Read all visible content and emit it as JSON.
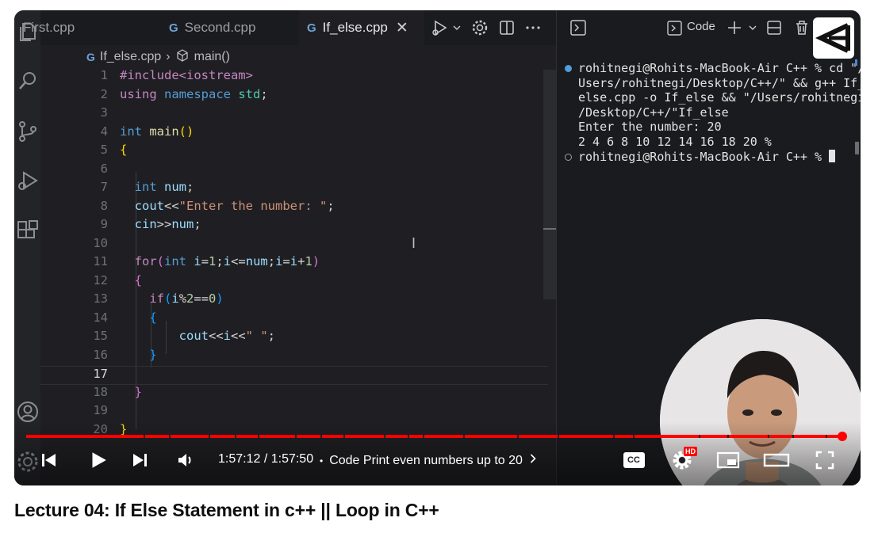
{
  "editor": {
    "tabs": [
      {
        "label": "First.cpp",
        "active": false
      },
      {
        "label": "Second.cpp",
        "active": false
      },
      {
        "label": "If_else.cpp",
        "active": true
      }
    ],
    "tab_file_glyph": "G",
    "tab_close_glyph": "✕",
    "breadcrumb": {
      "file": "If_else.cpp",
      "separator": "›",
      "symbol": "main()"
    },
    "current_line": 17,
    "lines": [
      {
        "n": "1",
        "tokens": [
          {
            "t": "#include<iostream>",
            "c": "pre"
          }
        ]
      },
      {
        "n": "2",
        "tokens": [
          {
            "t": "using ",
            "c": "pink"
          },
          {
            "t": "namespace ",
            "c": "blue"
          },
          {
            "t": "std",
            "c": "ns"
          },
          {
            "t": ";",
            "c": "op"
          }
        ]
      },
      {
        "n": "3",
        "tokens": []
      },
      {
        "n": "4",
        "tokens": [
          {
            "t": "int ",
            "c": "blue"
          },
          {
            "t": "main",
            "c": "fn"
          },
          {
            "t": "()",
            "c": "br1"
          }
        ]
      },
      {
        "n": "5",
        "tokens": [
          {
            "t": "{",
            "c": "br1"
          }
        ]
      },
      {
        "n": "6",
        "tokens": []
      },
      {
        "n": "7",
        "tokens": [
          {
            "t": "  int ",
            "c": "blue"
          },
          {
            "t": "num",
            "c": "ident"
          },
          {
            "t": ";",
            "c": "op"
          }
        ]
      },
      {
        "n": "8",
        "tokens": [
          {
            "t": "  cout",
            "c": "ident"
          },
          {
            "t": "<<",
            "c": "op"
          },
          {
            "t": "\"Enter the number: \"",
            "c": "str"
          },
          {
            "t": ";",
            "c": "op"
          }
        ]
      },
      {
        "n": "9",
        "tokens": [
          {
            "t": "  cin",
            "c": "ident"
          },
          {
            "t": ">>",
            "c": "op"
          },
          {
            "t": "num",
            "c": "ident"
          },
          {
            "t": ";",
            "c": "op"
          }
        ]
      },
      {
        "n": "10",
        "tokens": []
      },
      {
        "n": "11",
        "tokens": [
          {
            "t": "  for",
            "c": "pink"
          },
          {
            "t": "(",
            "c": "br2"
          },
          {
            "t": "int ",
            "c": "blue"
          },
          {
            "t": "i",
            "c": "ident"
          },
          {
            "t": "=",
            "c": "op"
          },
          {
            "t": "1",
            "c": "num"
          },
          {
            "t": ";",
            "c": "op"
          },
          {
            "t": "i",
            "c": "ident"
          },
          {
            "t": "<=",
            "c": "op"
          },
          {
            "t": "num",
            "c": "ident"
          },
          {
            "t": ";",
            "c": "op"
          },
          {
            "t": "i",
            "c": "ident"
          },
          {
            "t": "=",
            "c": "op"
          },
          {
            "t": "i",
            "c": "ident"
          },
          {
            "t": "+",
            "c": "op"
          },
          {
            "t": "1",
            "c": "num"
          },
          {
            "t": ")",
            "c": "br2"
          }
        ]
      },
      {
        "n": "12",
        "tokens": [
          {
            "t": "  {",
            "c": "br2"
          }
        ]
      },
      {
        "n": "13",
        "tokens": [
          {
            "t": "    if",
            "c": "pink"
          },
          {
            "t": "(",
            "c": "br3"
          },
          {
            "t": "i",
            "c": "ident"
          },
          {
            "t": "%",
            "c": "op"
          },
          {
            "t": "2",
            "c": "num"
          },
          {
            "t": "==",
            "c": "op"
          },
          {
            "t": "0",
            "c": "num"
          },
          {
            "t": ")",
            "c": "br3"
          }
        ]
      },
      {
        "n": "14",
        "tokens": [
          {
            "t": "    {",
            "c": "br3"
          }
        ]
      },
      {
        "n": "15",
        "tokens": [
          {
            "t": "        cout",
            "c": "ident"
          },
          {
            "t": "<<",
            "c": "op"
          },
          {
            "t": "i",
            "c": "ident"
          },
          {
            "t": "<<",
            "c": "op"
          },
          {
            "t": "\" \"",
            "c": "str"
          },
          {
            "t": ";",
            "c": "op"
          }
        ]
      },
      {
        "n": "16",
        "tokens": [
          {
            "t": "    }",
            "c": "br3"
          }
        ]
      },
      {
        "n": "17",
        "tokens": []
      },
      {
        "n": "18",
        "tokens": [
          {
            "t": "  }",
            "c": "br2"
          }
        ]
      },
      {
        "n": "19",
        "tokens": []
      },
      {
        "n": "20",
        "tokens": [
          {
            "t": "}",
            "c": "br1"
          }
        ]
      }
    ]
  },
  "terminal": {
    "toolbar_label": "Code",
    "lines": [
      {
        "marker": "blue",
        "text": "rohitnegi@Rohits-MacBook-Air C++ % cd \"/"
      },
      {
        "marker": "",
        "text": "Users/rohitnegi/Desktop/C++/\" && g++ If_"
      },
      {
        "marker": "",
        "text": "else.cpp -o If_else && \"/Users/rohitnegi"
      },
      {
        "marker": "",
        "text": "/Desktop/C++/\"If_else"
      },
      {
        "marker": "",
        "text": "Enter the number: 20"
      },
      {
        "marker": "",
        "text": "2 4 6 8 10 12 14 16 18 20 %"
      },
      {
        "marker": "hollow",
        "text": "rohitnegi@Rohits-MacBook-Air C++ % "
      }
    ]
  },
  "player": {
    "time_display": "1:57:12 / 1:57:50",
    "chapter_separator": "•",
    "chapter": "Code Print even numbers up to 20",
    "progress_fraction": 0.9946,
    "hd_badge": "HD",
    "cc_label": "CC",
    "accent_color": "#ff0000"
  },
  "video_title": "Lecture 04: If Else Statement in c++ || Loop in C++",
  "icons": [
    "files-icon",
    "search-icon",
    "source-control-icon",
    "run-debug-icon",
    "extensions-icon",
    "account-icon",
    "settings-gear-icon",
    "run-icon",
    "split-editor-icon",
    "more-icon",
    "terminal-icon",
    "plus-icon",
    "split-terminal-icon",
    "trash-icon",
    "play-icon",
    "previous-icon",
    "next-icon",
    "volume-icon",
    "captions-icon",
    "settings-icon",
    "miniplayer-icon",
    "theater-icon",
    "fullscreen-icon",
    "channel-logo"
  ]
}
